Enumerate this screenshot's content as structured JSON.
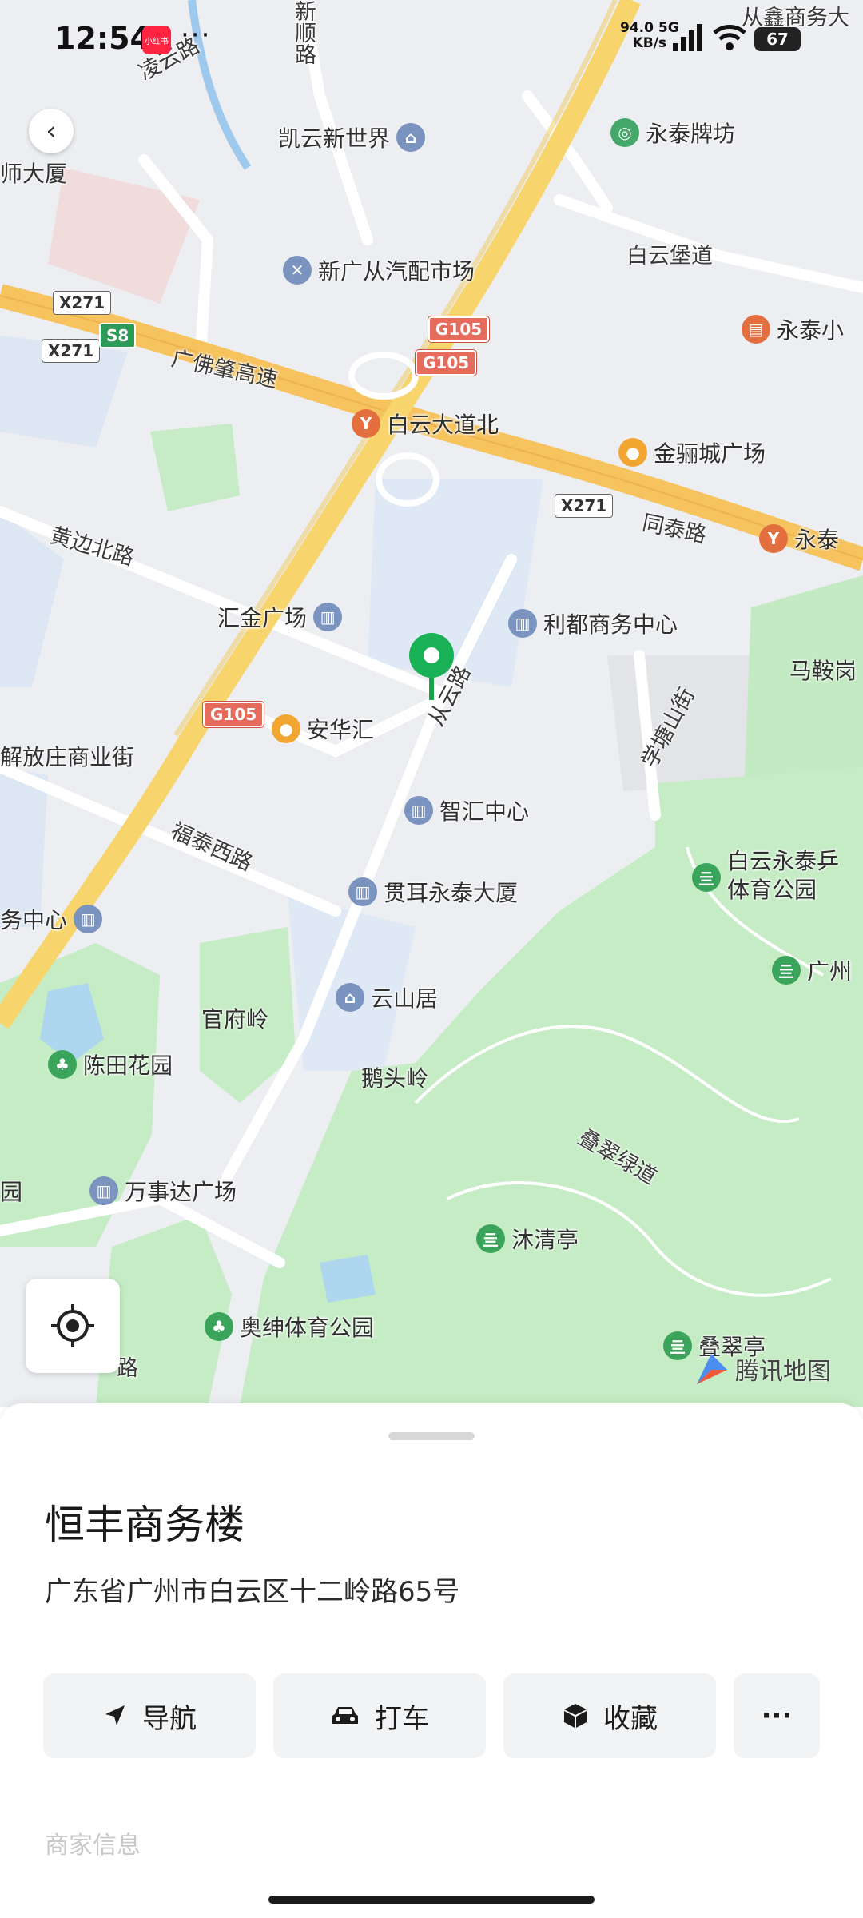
{
  "status_bar": {
    "time": "12:54",
    "app_badge": "小红书",
    "dots": "···",
    "net_speed": "94.0",
    "net_unit": "KB/s",
    "net_type": "5G",
    "battery": "67"
  },
  "map": {
    "pois": [
      {
        "label": "凯云新世界",
        "icon": "house-icon"
      },
      {
        "label": "永泰牌坊",
        "icon": "landmark-icon"
      },
      {
        "label": "新广从汽配市场",
        "icon": "tools-icon"
      },
      {
        "label": "永泰小",
        "icon": "school-icon"
      },
      {
        "label": "白云大道北",
        "icon": "metro-icon"
      },
      {
        "label": "金骊城广场",
        "icon": "shopping-icon"
      },
      {
        "label": "永泰",
        "icon": "metro-icon"
      },
      {
        "label": "汇金广场",
        "icon": "building-icon"
      },
      {
        "label": "利都商务中心",
        "icon": "building-icon"
      },
      {
        "label": "安华汇",
        "icon": "shopping-icon"
      },
      {
        "label": "智汇中心",
        "icon": "building-icon"
      },
      {
        "label": "贯耳永泰大厦",
        "icon": "building-icon"
      },
      {
        "label": "务中心",
        "icon": "building-icon"
      },
      {
        "label": "云山居",
        "icon": "house-icon"
      },
      {
        "label": "陈田花园",
        "icon": "tree-icon"
      },
      {
        "label": "万事达广场",
        "icon": "building-icon"
      },
      {
        "label": "白云永泰乒\n体育公园",
        "icon": "park-icon"
      },
      {
        "label": "广州",
        "icon": "park-icon"
      },
      {
        "label": "沐清亭",
        "icon": "park-icon"
      },
      {
        "label": "奥绅体育公园",
        "icon": "tree-icon"
      },
      {
        "label": "叠翠亭",
        "icon": "park-icon"
      }
    ],
    "plain_labels": [
      "师大厦",
      "解放庄商业街",
      "官府岭",
      "鹅头岭",
      "马鞍岗",
      "园"
    ],
    "roads": [
      "新顺路",
      "凌云路",
      "白云堡道",
      "广佛肇高速",
      "黄边北路",
      "同泰路",
      "从云路",
      "学塘山街",
      "福泰西路",
      "叠翠绿道",
      "路",
      "从鑫商务大"
    ],
    "shields": {
      "x271": "X271",
      "s8": "S8",
      "g105": "G105"
    },
    "logo": "腾讯地图"
  },
  "sheet": {
    "title": "恒丰商务楼",
    "address": "广东省广州市白云区十二岭路65号",
    "actions": {
      "navigate": "导航",
      "taxi": "打车",
      "favorite": "收藏",
      "more": "···"
    },
    "more_info": "商家信息"
  }
}
